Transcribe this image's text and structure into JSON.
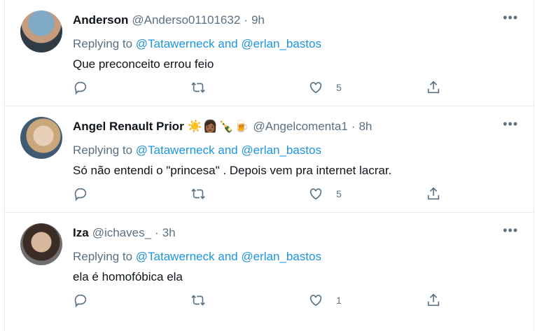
{
  "tweets": [
    {
      "name": "Anderson",
      "handle": "@Anderso01101632",
      "dot": "·",
      "time": "9h",
      "emoji": "",
      "replying_prefix": "Replying to",
      "mention1": "@Tatawerneck",
      "and": "and",
      "mention2": "@erlan_bastos",
      "text": "Que preconceito errou feio",
      "likes": "5"
    },
    {
      "name": "Angel Renault Prior",
      "handle": "@Angelcomenta1",
      "dot": "·",
      "time": "8h",
      "emoji": "☀️👩🏾🍾🍺",
      "replying_prefix": "Replying to",
      "mention1": "@Tatawerneck",
      "and": "and",
      "mention2": "@erlan_bastos",
      "text": "Só não entendi o \"princesa\" . Depois vem pra internet lacrar.",
      "likes": "5"
    },
    {
      "name": "Iza",
      "handle": "@ichaves_",
      "dot": "·",
      "time": "3h",
      "emoji": "",
      "replying_prefix": "Replying to",
      "mention1": "@Tatawerneck",
      "and": "and",
      "mention2": "@erlan_bastos",
      "text": "ela é homofóbica ela",
      "likes": "1"
    }
  ],
  "icons": {
    "more": "more-horizontal-icon",
    "reply": "reply-bubble-icon",
    "retweet": "retweet-icon",
    "like": "heart-icon",
    "share": "share-icon"
  },
  "colors": {
    "text": "#0f1419",
    "secondary": "#5b7083",
    "link": "#1b95e0",
    "divider": "#e6ecf0"
  }
}
